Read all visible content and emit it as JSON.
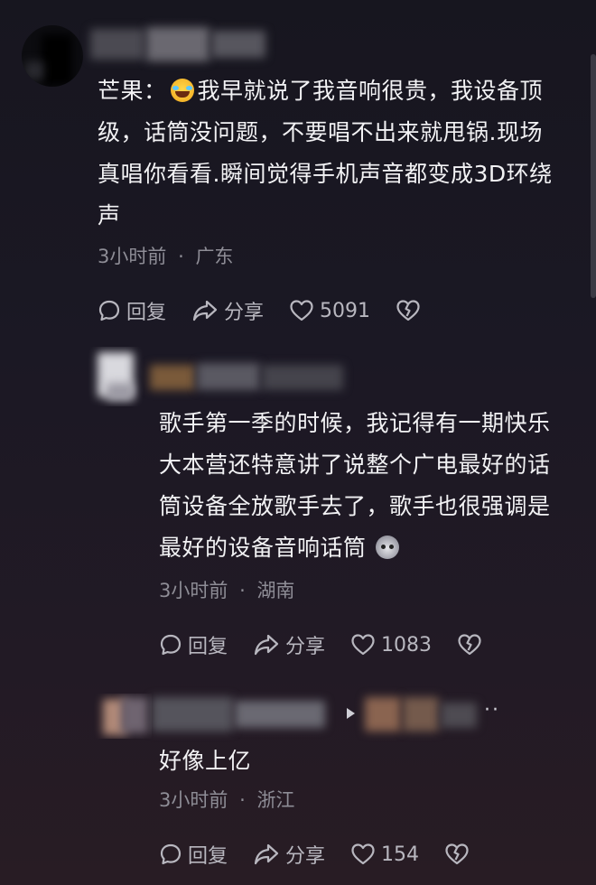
{
  "comments": [
    {
      "author_prefix": "芒果：",
      "text_lines": [
        "我早就说了我音响很贵，我设备顶",
        "级，话筒没问题，不要唱不出来就甩锅.现场",
        "真唱你看看.瞬间觉得手机声音都变成3D环绕",
        "声"
      ],
      "emoji": "laughing-face-emoji",
      "time": "3小时前",
      "location": "广东",
      "reply_label": "回复",
      "share_label": "分享",
      "likes": "5091"
    },
    {
      "text_lines": [
        "歌手第一季的时候，我记得有一期快乐",
        "大本营还特意讲了说整个广电最好的话",
        "筒设备全放歌手去了，歌手也很强调是",
        "最好的设备音响话筒"
      ],
      "emoji": "cat-face-emoji",
      "time": "3小时前",
      "location": "湖南",
      "reply_label": "回复",
      "share_label": "分享",
      "likes": "1083"
    },
    {
      "text_lines": [
        "好像上亿"
      ],
      "time": "3小时前",
      "location": "浙江",
      "reply_label": "回复",
      "share_label": "分享",
      "likes": "154",
      "more_label": "··"
    }
  ],
  "meta_separator": "·",
  "colors": {
    "background": "#1b1824",
    "text": "#f2f2f4",
    "meta": "#8e8d96",
    "action": "#b8b7bf"
  }
}
